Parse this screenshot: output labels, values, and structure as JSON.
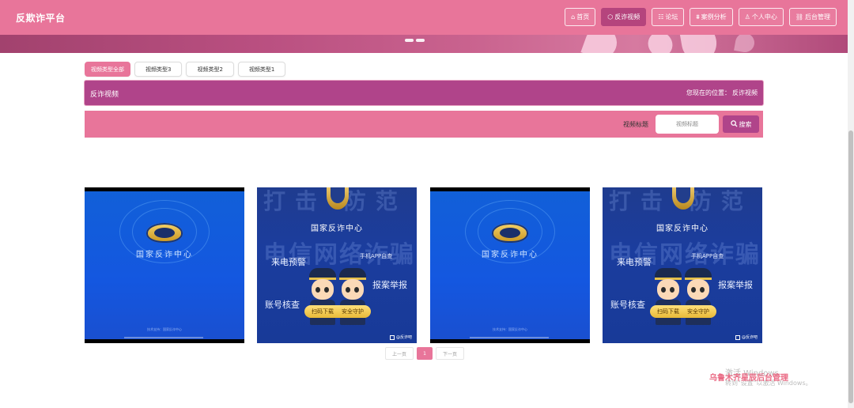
{
  "site": {
    "title": "反欺诈平台"
  },
  "nav": {
    "items": [
      {
        "icon": "⌂",
        "label": "首页"
      },
      {
        "icon": "⬡",
        "label": "反诈视频",
        "active": true
      },
      {
        "icon": "☷",
        "label": "论坛"
      },
      {
        "icon": "⩩",
        "label": "案例分析"
      },
      {
        "icon": "♙",
        "label": "个人中心"
      },
      {
        "icon": "⛓",
        "label": "后台管理"
      }
    ]
  },
  "filters": {
    "tabs": [
      {
        "label": "视频类型全部",
        "active": true
      },
      {
        "label": "视频类型3"
      },
      {
        "label": "视频类型2"
      },
      {
        "label": "视频类型1"
      }
    ]
  },
  "breadcrumb": {
    "title": "反诈视频",
    "prefix": "您现在的位置：",
    "current": "反诈视频"
  },
  "search": {
    "label": "视频标题",
    "placeholder": "视频标题",
    "button": "搜索",
    "icon": "search-icon"
  },
  "videos": [
    {
      "variant": "a",
      "text": "国家反诈中心",
      "small": "技术支持：国家反诈中心"
    },
    {
      "variant": "b",
      "watermark1": "打击  防范",
      "watermark2": "电信网络诈骗",
      "title": "国家反诈中心",
      "left1": "来电预警",
      "right1": "手机APP自查",
      "right2": "报案举报",
      "left2": "账号核查",
      "sign_left": "扫码下载",
      "sign_right": "安全守护",
      "brand": "@反诈吧"
    },
    {
      "variant": "a",
      "text": "国家反诈中心",
      "small": "技术支持：国家反诈中心"
    },
    {
      "variant": "b",
      "watermark1": "打击  防范",
      "watermark2": "电信网络诈骗",
      "title": "国家反诈中心",
      "left1": "来电预警",
      "right1": "手机APP自查",
      "right2": "报案举报",
      "left2": "账号核查",
      "sign_left": "扫码下载",
      "sign_right": "安全守护",
      "brand": "@反诈吧"
    }
  ],
  "pagination": {
    "prev": "上一页",
    "current": "1",
    "next": "下一页"
  },
  "overlay": {
    "line1": "激活 Windows",
    "line2": "转到\"设置\"以激活 Windows。",
    "brand": "乌鲁木齐星辰后台管理"
  },
  "colors": {
    "primary": "#e8759a",
    "accent": "#b0448a",
    "video_blue": "#1457e0"
  }
}
